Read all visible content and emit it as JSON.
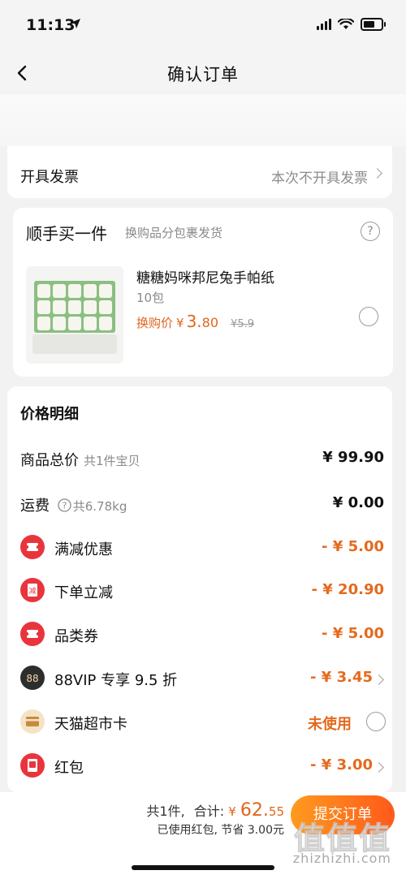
{
  "status_bar": {
    "time": "11:13"
  },
  "nav": {
    "title": "确认订单"
  },
  "invoice": {
    "label": "开具发票",
    "value": "本次不开具发票"
  },
  "addon": {
    "title": "顺手买一件",
    "subtitle": "换购品分包裹发货",
    "help_glyph": "?",
    "product": {
      "name": "糖糖妈咪邦尼兔手帕纸",
      "spec": "10包",
      "price_label": "换购价",
      "price_symbol": "¥",
      "price_main": "3.",
      "price_decimal": "80",
      "old_price": "¥5.9"
    }
  },
  "price_detail": {
    "title": "价格明细",
    "rows": [
      {
        "label": "商品总价",
        "sub": "共1件宝贝",
        "value": "¥ 99.90"
      },
      {
        "label": "运费",
        "sub": "共6.78kg",
        "value": "¥ 0.00"
      },
      {
        "label": "满减优惠",
        "value": "- ¥ 5.00",
        "icon": "coupon-ticket-icon"
      },
      {
        "label": "下单立减",
        "value": "- ¥ 20.90",
        "icon": "instant-discount-icon",
        "icon_glyph": "减"
      },
      {
        "label": "品类券",
        "value": "- ¥ 5.00",
        "icon": "category-coupon-icon"
      },
      {
        "label": "88VIP 专享 9.5 折",
        "value": "- ¥ 3.45",
        "icon": "vip88-icon",
        "icon_glyph": "88"
      },
      {
        "label": "天猫超市卡",
        "value": "未使用",
        "icon": "supermarket-card-icon"
      },
      {
        "label": "红包",
        "value": "- ¥ 3.00",
        "icon": "red-packet-icon"
      }
    ]
  },
  "bottom": {
    "count_text": "共1件,",
    "total_label": "合计:",
    "total_symbol": "¥",
    "total_main": "62.",
    "total_decimal": "55",
    "saved_text": "已使用红包, 节省 3.00元",
    "submit_label": "提交订单"
  },
  "watermark": {
    "glyphs": "值值值",
    "url": "zhizhizhi.com"
  },
  "colors": {
    "accent": "#e0661c",
    "discount": "#e56a1e",
    "red_icon": "#e8353d",
    "submit_start": "#ff9a1f",
    "submit_end": "#ff5a1a"
  }
}
